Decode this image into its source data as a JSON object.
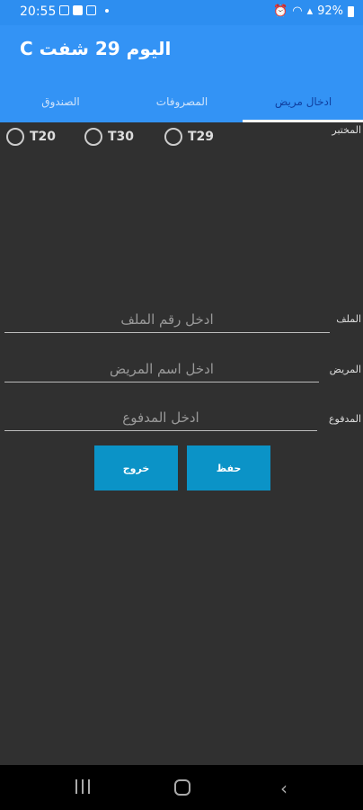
{
  "status": {
    "time": "20:55",
    "battery": "92%"
  },
  "app": {
    "title": "اليوم 29  شفت C"
  },
  "tabs": [
    {
      "label": "الصندوق"
    },
    {
      "label": "المصروفات"
    },
    {
      "label": "ادخال مريض"
    }
  ],
  "lab": {
    "label": "المختبر",
    "options": [
      "T20",
      "T30",
      "T29"
    ]
  },
  "fields": {
    "file": {
      "label": "الملف",
      "placeholder": "ادخل رقم الملف"
    },
    "patient": {
      "label": "المريض",
      "placeholder": "ادخل اسم المريض"
    },
    "paid": {
      "label": "المدفوع",
      "placeholder": "ادخل المدفوع"
    }
  },
  "buttons": {
    "exit": "خروج",
    "save": "حفظ"
  },
  "colors": {
    "status_bar": "#2d8ef0",
    "app_bar": "#3393f5",
    "background": "#303030",
    "button": "#0b93c7"
  }
}
